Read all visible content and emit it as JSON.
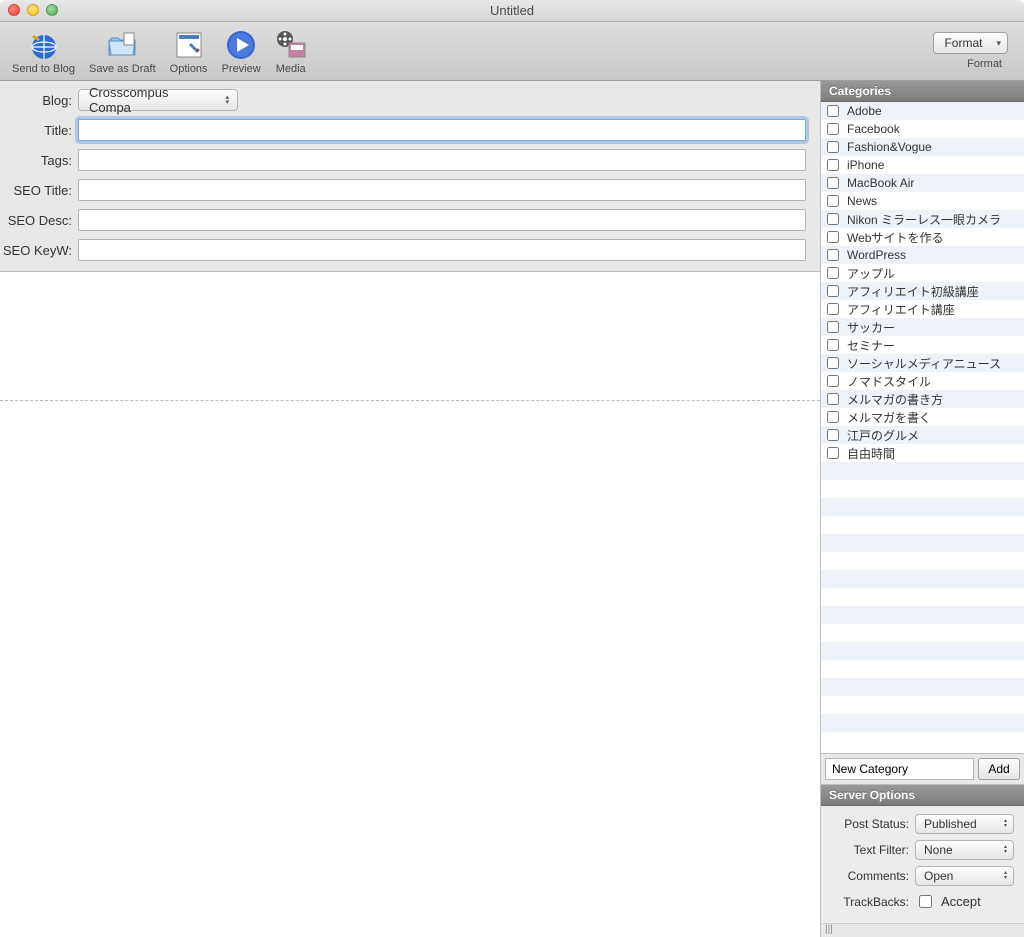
{
  "window": {
    "title": "Untitled"
  },
  "toolbar": {
    "items": [
      {
        "label": "Send to Blog"
      },
      {
        "label": "Save as Draft"
      },
      {
        "label": "Options"
      },
      {
        "label": "Preview"
      },
      {
        "label": "Media"
      }
    ],
    "format_button": "Format",
    "format_label": "Format"
  },
  "fields": {
    "blog": {
      "label": "Blog:",
      "value": "Crosscompus Compa"
    },
    "title": {
      "label": "Title:",
      "value": ""
    },
    "tags": {
      "label": "Tags:",
      "value": ""
    },
    "seo_title": {
      "label": "SEO Title:",
      "value": ""
    },
    "seo_desc": {
      "label": "SEO Desc:",
      "value": ""
    },
    "seo_keyw": {
      "label": "SEO KeyW:",
      "value": ""
    }
  },
  "sidebar": {
    "categories_header": "Categories",
    "categories": [
      "Adobe",
      "Facebook",
      "Fashion&Vogue",
      "iPhone",
      "MacBook Air",
      "News",
      "Nikon ミラーレス一眼カメラ",
      "Webサイトを作る",
      "WordPress",
      "アップル",
      "アフィリエイト初級講座",
      "アフィリエイト講座",
      "サッカー",
      "セミナー",
      "ソーシャルメディアニュース",
      "ノマドスタイル",
      "メルマガの書き方",
      "メルマガを書く",
      "江戸のグルメ",
      "自由時間"
    ],
    "new_category_placeholder": "New Category",
    "add_button": "Add",
    "server_options_header": "Server Options",
    "server_options": {
      "post_status": {
        "label": "Post Status:",
        "value": "Published"
      },
      "text_filter": {
        "label": "Text Filter:",
        "value": "None"
      },
      "comments": {
        "label": "Comments:",
        "value": "Open"
      },
      "trackbacks": {
        "label": "TrackBacks:",
        "checkbox_label": "Accept"
      }
    }
  }
}
